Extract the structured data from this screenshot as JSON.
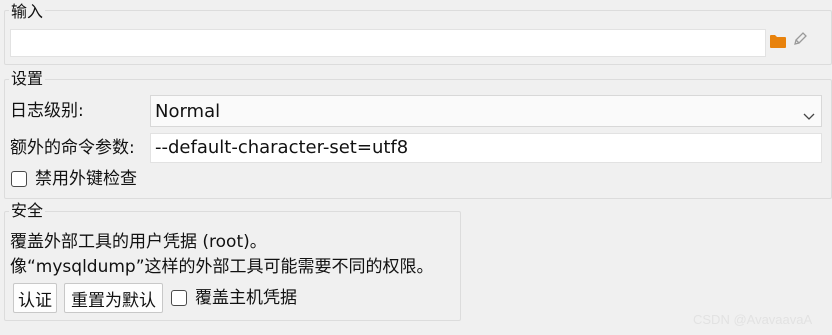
{
  "input_section": {
    "title": "输入",
    "path_value": "",
    "folder_icon": "folder-icon",
    "edit_icon": "pencil-icon"
  },
  "settings_section": {
    "title": "设置",
    "log_level_label": "日志级别:",
    "log_level_value": "Normal",
    "extra_args_label": "额外的命令参数:",
    "extra_args_value": "--default-character-set=utf8",
    "disable_fk_label": "禁用外键检查"
  },
  "security_section": {
    "title": "安全",
    "line1": "覆盖外部工具的用户凭据 (root)。",
    "line2": "像“mysqldump”这样的外部工具可能需要不同的权限。",
    "auth_button": "认证",
    "reset_button": "重置为默认",
    "override_host_label": "覆盖主机凭据"
  },
  "watermark": "CSDN @AvavaavaA",
  "colors": {
    "folder": "#e8820c",
    "background": "#f0f0f0"
  }
}
